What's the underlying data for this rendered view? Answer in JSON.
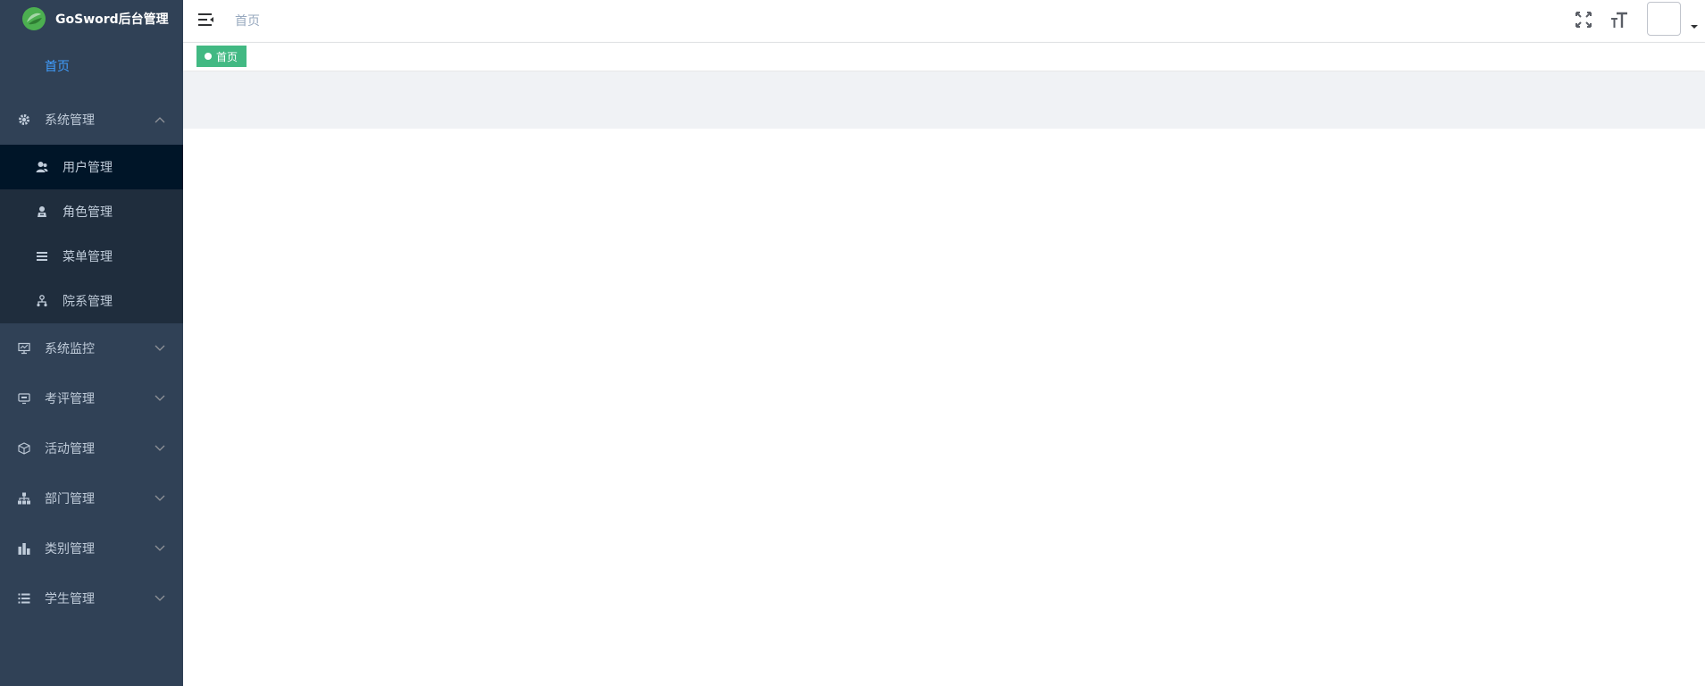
{
  "app": {
    "title": "GoSword后台管理"
  },
  "colors": {
    "sidebar_bg": "#304156",
    "submenu_bg": "#1f2d3d",
    "active_sub_bg": "#001528",
    "accent": "#409eff",
    "tag_green": "#42b983",
    "menu_text": "#bfcbd9"
  },
  "sidebar": {
    "home": {
      "label": "首页"
    },
    "system": {
      "label": "系统管理",
      "icon": "gear-icon",
      "expanded": true,
      "children": [
        {
          "label": "用户管理",
          "icon": "user-icon",
          "active": true
        },
        {
          "label": "角色管理",
          "icon": "role-icon"
        },
        {
          "label": "菜单管理",
          "icon": "menu-list-icon"
        },
        {
          "label": "院系管理",
          "icon": "tree-icon"
        }
      ]
    },
    "items": [
      {
        "label": "系统监控",
        "icon": "monitor-icon"
      },
      {
        "label": "考评管理",
        "icon": "screen-icon"
      },
      {
        "label": "活动管理",
        "icon": "cube-icon"
      },
      {
        "label": "部门管理",
        "icon": "org-icon"
      },
      {
        "label": "类别管理",
        "icon": "bar-chart-icon"
      },
      {
        "label": "学生管理",
        "icon": "list-icon"
      }
    ]
  },
  "navbar": {
    "breadcrumb": "首页",
    "icons": [
      "hamburger-icon",
      "fullscreen-icon",
      "font-size-icon",
      "avatar",
      "caret-down-icon"
    ]
  },
  "tags": [
    {
      "label": "首页",
      "active": true
    }
  ]
}
